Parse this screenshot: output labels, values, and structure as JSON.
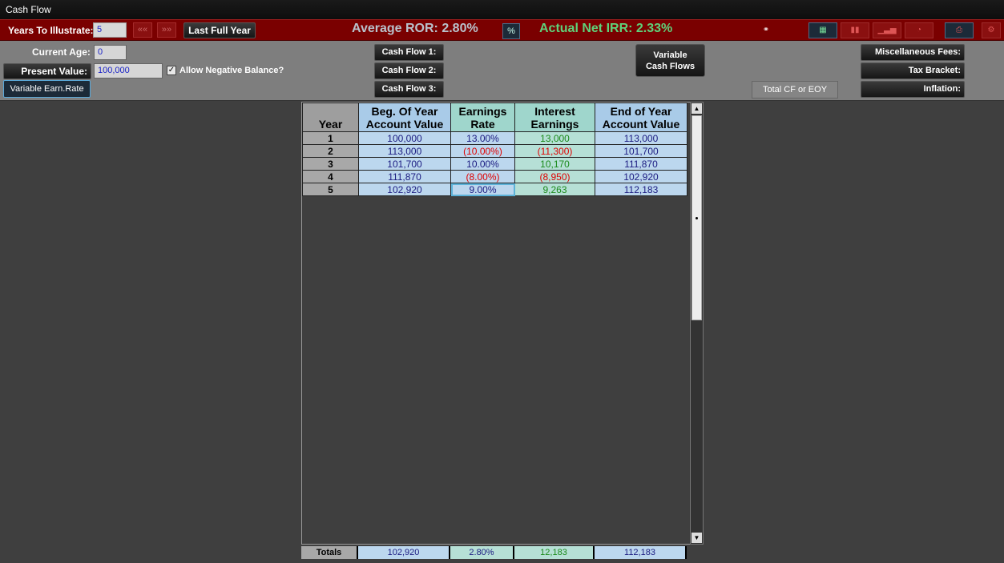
{
  "window": {
    "title": "Cash Flow"
  },
  "toolbar": {
    "years_label": "Years To Illustrate:",
    "years_value": "5",
    "prev_icon": "double-chevron-left-icon",
    "next_icon": "double-chevron-right-icon",
    "last_full_year_label": "Last Full Year",
    "average_ror": "Average ROR: 2.80%",
    "actual_net_irr": "Actual Net IRR: 2.33%",
    "percent_button": "%",
    "colors": {
      "average_ror": "#b9c2cc",
      "actual_net_irr": "#5fd27a",
      "bar": "#7a0000"
    }
  },
  "controls": {
    "current_age_label": "Current Age:",
    "current_age_value": "0",
    "present_value_label": "Present Value:",
    "present_value_value": "100,000",
    "allow_negative_label": "Allow Negative Balance?",
    "allow_negative_checked": "✓",
    "variable_earn_rate": "Variable Earn.Rate",
    "cash_flow_1": "Cash Flow 1:",
    "cash_flow_2": "Cash Flow 2:",
    "cash_flow_3": "Cash Flow 3:",
    "variable_cash_flows_line1": "Variable",
    "variable_cash_flows_line2": "Cash Flows",
    "total_cf_or_eoy": "Total CF or EOY",
    "misc_fees": "Miscellaneous Fees:",
    "tax_bracket": "Tax Bracket:",
    "inflation": "Inflation:"
  },
  "table": {
    "headers": {
      "year": "Year",
      "beg_line1": "Beg. Of Year",
      "beg_line2": "Account Value",
      "rate_line1": "Earnings",
      "rate_line2": "Rate",
      "int_line1": "Interest",
      "int_line2": "Earnings",
      "end_line1": "End of Year",
      "end_line2": "Account Value"
    },
    "rows": [
      {
        "year": "1",
        "beg": "100,000",
        "rate": "13.00%",
        "interest": "13,000",
        "end": "113,000"
      },
      {
        "year": "2",
        "beg": "113,000",
        "rate": "(10.00%)",
        "interest": "(11,300)",
        "end": "101,700"
      },
      {
        "year": "3",
        "beg": "101,700",
        "rate": "10.00%",
        "interest": "10,170",
        "end": "111,870"
      },
      {
        "year": "4",
        "beg": "111,870",
        "rate": "(8.00%)",
        "interest": "(8,950)",
        "end": "102,920"
      },
      {
        "year": "5",
        "beg": "102,920",
        "rate": "9.00%",
        "interest": "9,263",
        "end": "112,183"
      }
    ],
    "totals": {
      "label": "Totals",
      "beg": "102,920",
      "rate": "2.80%",
      "interest": "12,183",
      "end": "112,183"
    }
  }
}
